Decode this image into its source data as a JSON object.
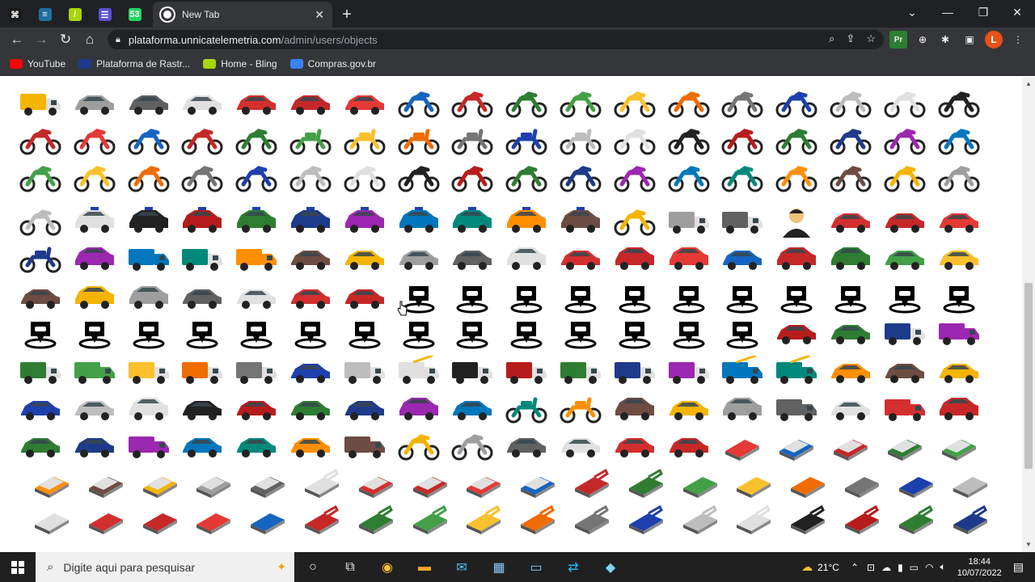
{
  "browser": {
    "pinned_tabs": [
      {
        "icon": "terminal-icon",
        "color": "#1a1a1a",
        "glyph": "⌘"
      },
      {
        "icon": "ticket-icon",
        "color": "#1f6f9f",
        "glyph": "≡"
      },
      {
        "icon": "bling-icon",
        "color": "#a8d600",
        "glyph": "/"
      },
      {
        "icon": "list-icon",
        "color": "#5a4fcf",
        "glyph": "☰"
      },
      {
        "icon": "whatsapp-icon",
        "color": "#25d366",
        "glyph": "53"
      }
    ],
    "active_tab": {
      "title": "New Tab"
    },
    "url_host": "plataforma.unnicatelemetria.com",
    "url_path": "/admin/users/objects",
    "profile_initial": "L",
    "accent": "#e8501a"
  },
  "bookmarks": [
    {
      "label": "YouTube",
      "color": "#ff0000"
    },
    {
      "label": "Plataforma de Rastr...",
      "color": "#1e3a8a"
    },
    {
      "label": "Home - Bling",
      "color": "#a8d600"
    },
    {
      "label": "Compras.gov.br",
      "color": "#3b82f6"
    }
  ],
  "page": {
    "rows": [
      [
        "truck",
        "car",
        "car",
        "car",
        "car",
        "car",
        "car",
        "moto",
        "moto",
        "moto",
        "moto",
        "moto",
        "moto",
        "moto",
        "moto",
        "moto",
        "moto",
        "moto"
      ],
      [
        "moto",
        "moto",
        "moto",
        "moto",
        "moto",
        "scooter",
        "scooter",
        "scooter",
        "scooter",
        "scooter",
        "scooter",
        "moto",
        "moto",
        "moto",
        "moto",
        "moto",
        "moto",
        "moto"
      ],
      [
        "moto",
        "moto",
        "moto",
        "moto",
        "moto",
        "moto",
        "moto",
        "moto",
        "moto",
        "moto",
        "moto",
        "moto",
        "moto",
        "moto",
        "moto",
        "moto",
        "moto",
        "moto"
      ],
      [
        "moto",
        "police",
        "police",
        "police",
        "police",
        "police",
        "police",
        "police",
        "police",
        "police",
        "police",
        "moto",
        "truck",
        "truck",
        "person",
        "sportscar",
        "sportscar",
        "sportscar"
      ],
      [
        "scooter",
        "suv",
        "tractor",
        "truck",
        "van",
        "car",
        "car",
        "car",
        "car",
        "pickup",
        "car",
        "suv",
        "suv",
        "car",
        "suv",
        "suv",
        "car",
        "car"
      ],
      [
        "car",
        "pickup",
        "pickup",
        "car",
        "car",
        "car",
        "car",
        "pin",
        "pin",
        "pin",
        "pin",
        "pin",
        "pin",
        "pin",
        "pin",
        "pin",
        "pin",
        "pin"
      ],
      [
        "pin",
        "pin",
        "pin",
        "pin",
        "pin",
        "pin",
        "pin",
        "pin",
        "pin",
        "pin",
        "pin",
        "pin",
        "pin",
        "pin",
        "car",
        "car",
        "truck",
        "tractor"
      ],
      [
        "truck",
        "van",
        "truck",
        "truck",
        "truck",
        "car",
        "truck",
        "crane",
        "truck",
        "truck",
        "truck",
        "truck",
        "truck",
        "crane",
        "crane",
        "car",
        "car",
        "car"
      ],
      [
        "car",
        "car",
        "suv",
        "car",
        "car",
        "car",
        "car",
        "pickup",
        "car",
        "scooter",
        "scooter",
        "pickup",
        "car",
        "suv",
        "van",
        "car",
        "loader",
        "pickup"
      ],
      [
        "car",
        "car",
        "tractor",
        "car",
        "car",
        "car",
        "tractor",
        "moto",
        "moto",
        "car",
        "car",
        "car",
        "car",
        "iso-car",
        "iso-truck",
        "iso-truck",
        "iso-truck",
        "iso-truck"
      ],
      [
        "iso-truck",
        "iso-truck",
        "iso-truck",
        "iso-truck",
        "iso-truck",
        "iso-machine",
        "iso-truck",
        "iso-truck",
        "iso-truck",
        "iso-truck",
        "iso-machine",
        "iso-machine",
        "iso-car",
        "iso-car",
        "iso-car",
        "iso-car",
        "iso-car",
        "iso-car"
      ],
      [
        "iso-car",
        "iso-car",
        "iso-car",
        "iso-car",
        "iso-car",
        "iso-machine",
        "iso-machine",
        "iso-machine",
        "iso-machine",
        "iso-machine",
        "iso-machine",
        "iso-machine",
        "iso-machine",
        "iso-machine",
        "iso-machine",
        "iso-machine",
        "iso-machine",
        "iso-machine"
      ]
    ],
    "palette": [
      "#f4b400",
      "#9e9e9e",
      "#616161",
      "#e0e0e0",
      "#d32f2f",
      "#c62828",
      "#e53935",
      "#1565c0",
      "#c62828",
      "#2e7d32",
      "#43a047",
      "#fbc02d",
      "#ef6c00",
      "#757575",
      "#1e40af",
      "#bdbdbd",
      "#e0e0e0",
      "#212121",
      "#b71c1c",
      "#2e7d32",
      "#1e3a8a",
      "#9c27b0",
      "#0277bd",
      "#00897b",
      "#ff8f00",
      "#6d4c41"
    ]
  },
  "taskbar": {
    "search_placeholder": "Digite aqui para pesquisar",
    "weather": "21°C",
    "time": "18:44",
    "date": "10/07/2022"
  }
}
